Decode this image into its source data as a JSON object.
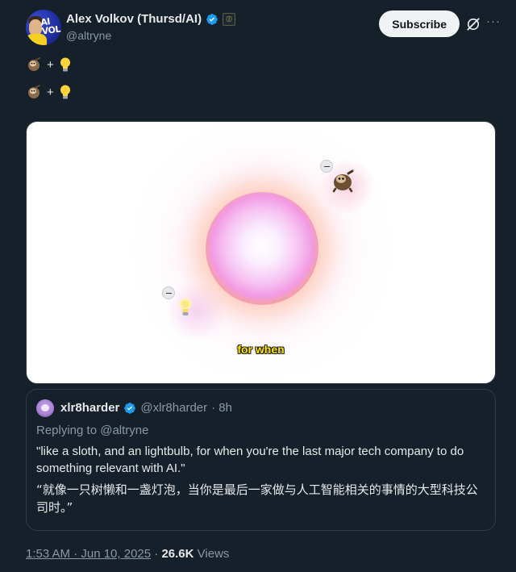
{
  "post": {
    "author": {
      "display_name": "Alex Volkov (Thursd/AI)",
      "handle": "@altryne",
      "avatar_text": "AI\nVOL",
      "verified": true
    },
    "subscribe_label": "Subscribe",
    "more_label": "···",
    "lines": [
      {
        "emojis": [
          "sloth",
          "lightbulb"
        ],
        "plus": "+"
      },
      {
        "emojis": [
          "sloth",
          "lightbulb"
        ],
        "plus": "+"
      }
    ],
    "media": {
      "caption": "for when"
    },
    "timestamp": "1:53 AM · Jun 10, 2025",
    "separator": "·",
    "views_count": "26.6K",
    "views_label": "Views"
  },
  "quote": {
    "display_name": "xlr8harder",
    "handle": "@xlr8harder",
    "time": "· 8h",
    "replying_to": "Replying to @altryne",
    "text_en": "\"like a sloth, and an lightbulb, for when you're the last major tech company to do something relevant with AI.\"",
    "text_zh": "“就像一只树懒和一盏灯泡，当你是最后一家做与人工智能相关的事情的大型科技公司时。”"
  },
  "colors": {
    "background": "#15202b",
    "text": "#e7e9ea",
    "muted": "#8b98a5",
    "verified_blue": "#1d9bf0",
    "caption_yellow": "#ffe600"
  }
}
